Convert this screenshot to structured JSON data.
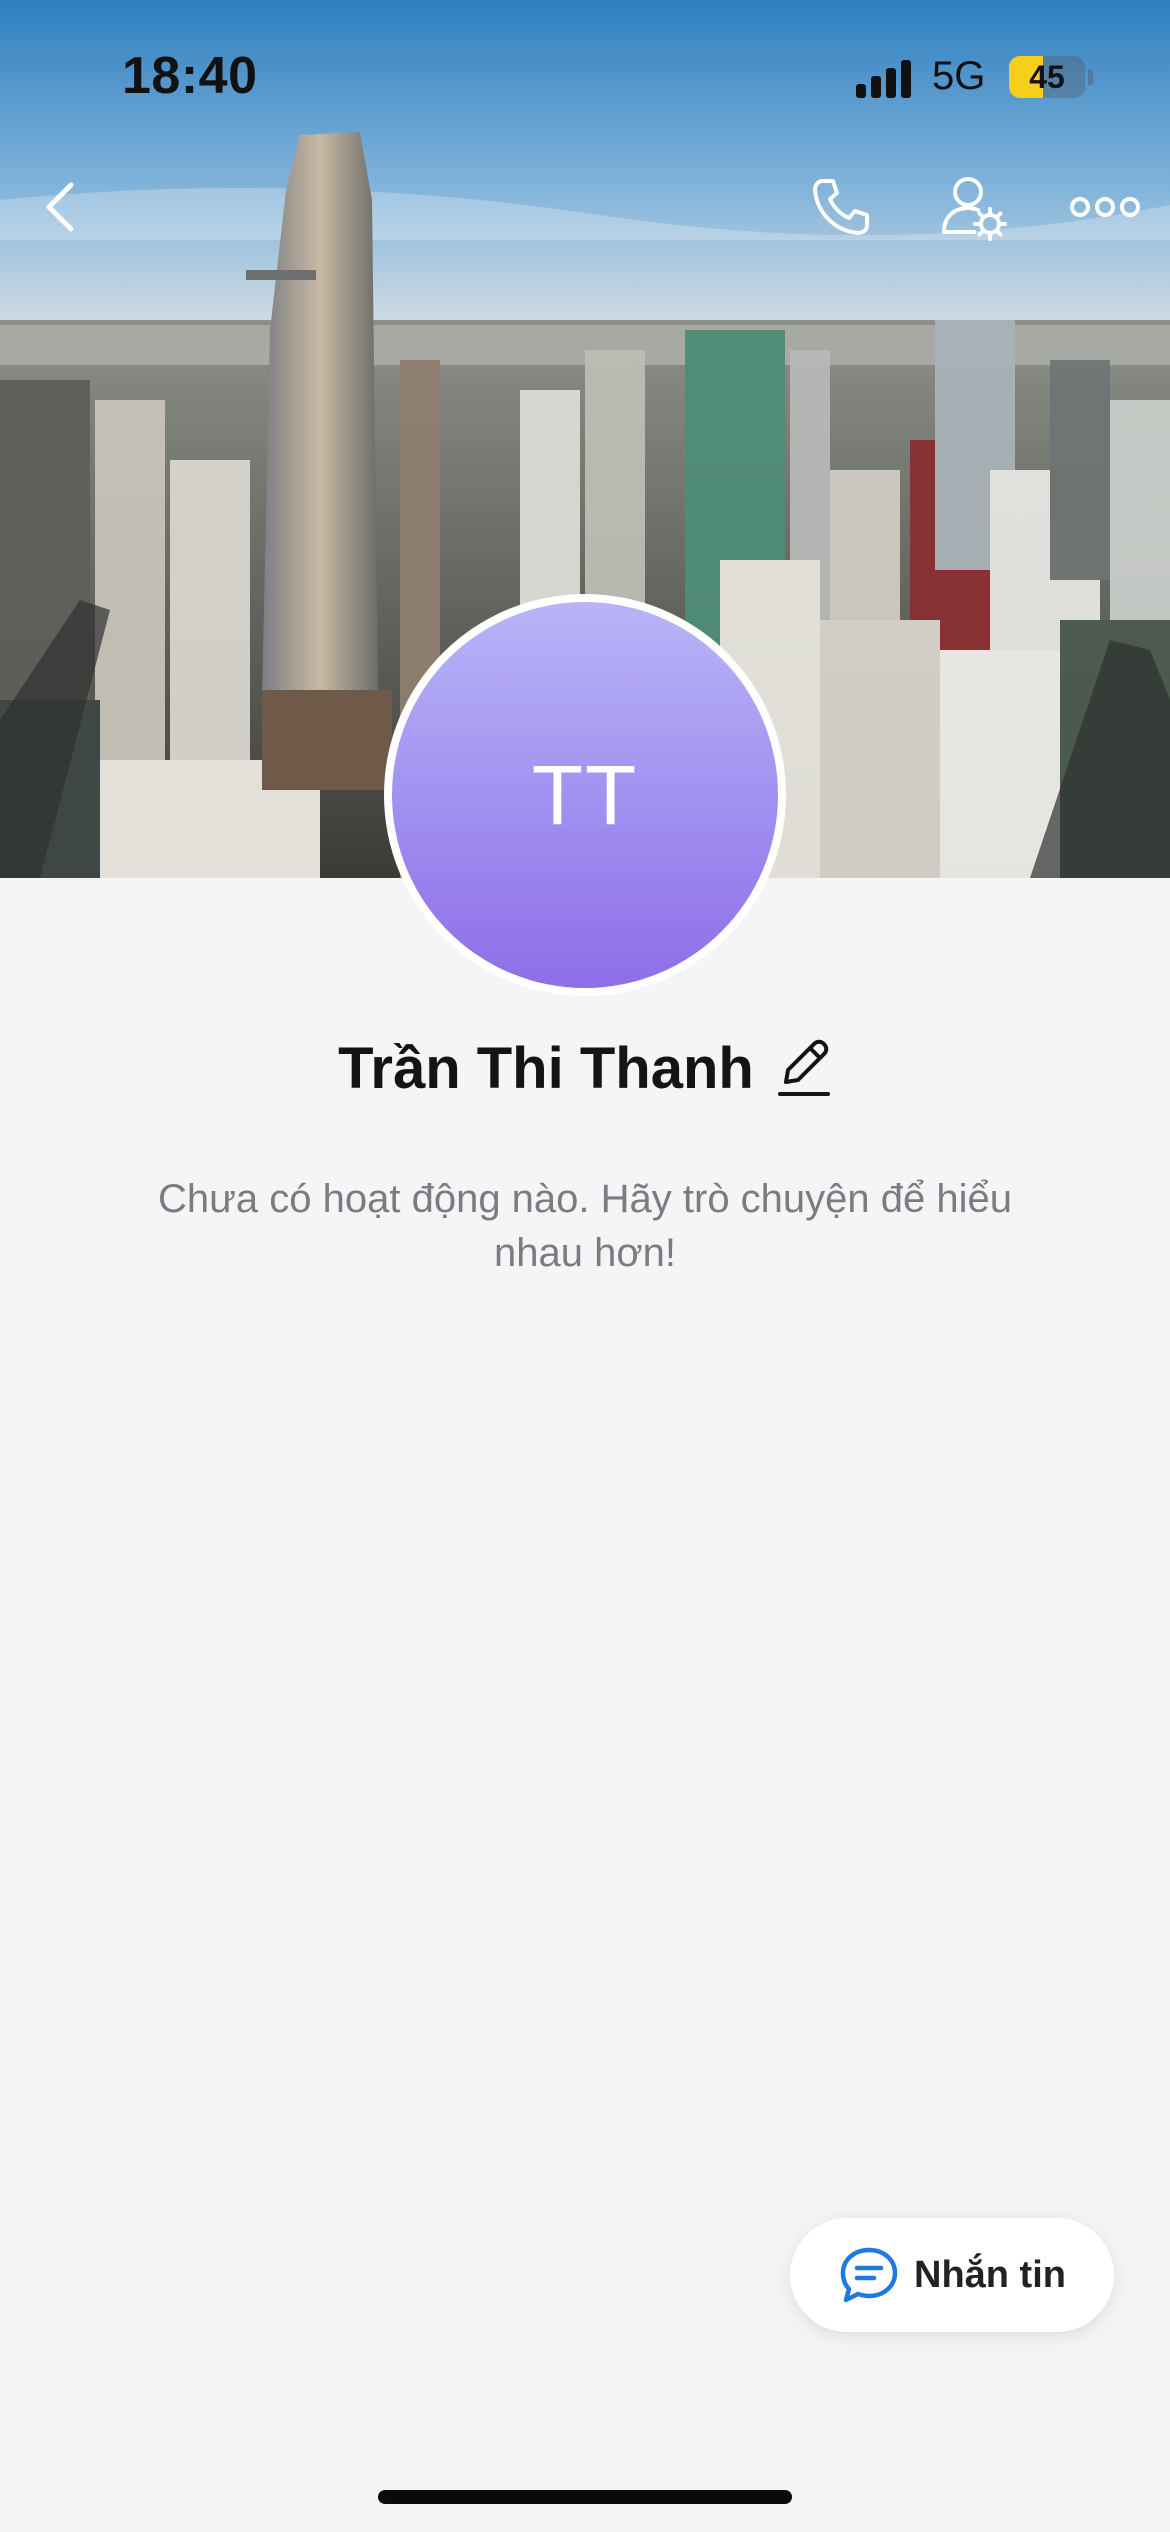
{
  "status_bar": {
    "time": "18:40",
    "network": "5G",
    "battery": "45",
    "battery_level": 0.45
  },
  "nav": {
    "back_icon": "chevron-left-icon",
    "call_icon": "phone-icon",
    "settings_icon": "user-settings-icon",
    "more_icon": "more-horizontal-icon"
  },
  "profile": {
    "avatar_initials": "TT",
    "name": "Trần Thi Thanh",
    "edit_icon": "pencil-icon",
    "empty_message": "Chưa có hoạt động nào. Hãy trò chuyện để hiểu nhau hơn!"
  },
  "actions": {
    "message_label": "Nhắn tin",
    "message_icon": "chat-bubble-icon"
  },
  "colors": {
    "avatar_top": "#b9b4f8",
    "avatar_bottom": "#8f6ee8",
    "accent_blue": "#1f7ae0",
    "background": "#f4f5f7",
    "battery": "#f6cf1d"
  }
}
